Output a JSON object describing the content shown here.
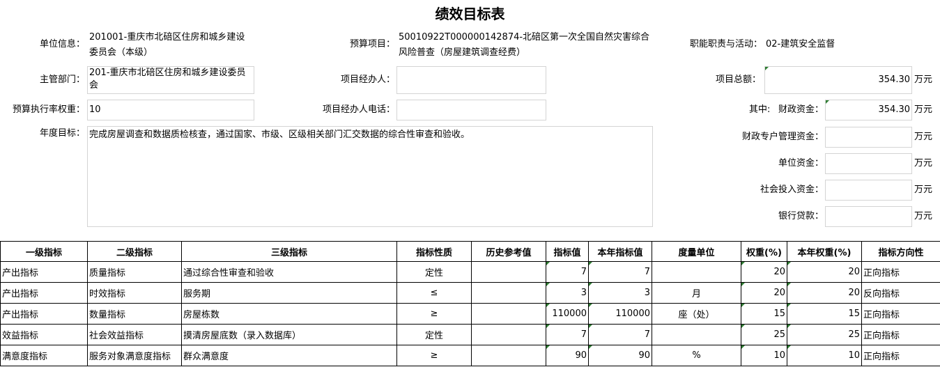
{
  "title": "绩效目标表",
  "fields": {
    "unit_info_label": "单位信息：",
    "unit_info_value_line1": "201001-重庆市北碚区住房和城乡建设",
    "unit_info_value_line2": "委员会（本级）",
    "budget_project_label": "预算项目：",
    "budget_project_value_line1": "50010922T000000142874-北碚区第一次全国自然灾害综合",
    "budget_project_value_line2": "风险普查（房屋建筑调查经费）",
    "function_label": "职能职责与活动：",
    "function_value": "02-建筑安全监督",
    "dept_label": "主管部门：",
    "dept_value_line1": "201-重庆市北碚区住房和城乡建设委员",
    "dept_value_line2": "会",
    "manager_label": "项目经办人：",
    "manager_value": "",
    "total_label": "项目总额：",
    "total_value": "354.30",
    "weight_label": "预算执行率权重：",
    "weight_value": "10",
    "manager_phone_label": "项目经办人电话：",
    "manager_phone_value": "",
    "fiscal_prefix": "其中:",
    "fiscal_label": "财政资金：",
    "fiscal_value": "354.30",
    "annual_goal_label": "年度目标：",
    "annual_goal_value": "完成房屋调查和数据质检核查，通过国家、市级、区级相关部门汇交数据的综合性审查和验收。",
    "special_label": "财政专户管理资金：",
    "special_value": "",
    "unit_funds_label": "单位资金：",
    "unit_funds_value": "",
    "social_label": "社会投入资金：",
    "social_value": "",
    "bank_label": "银行贷款：",
    "bank_value": "",
    "currency_unit": "万元"
  },
  "table": {
    "headers": [
      "一级指标",
      "二级指标",
      "三级指标",
      "指标性质",
      "历史参考值",
      "指标值",
      "本年指标值",
      "度量单位",
      "权重(%)",
      "本年权重(%)",
      "指标方向性"
    ],
    "rows": [
      {
        "l1": "产出指标",
        "l2": "质量指标",
        "l3": "通过综合性审查和验收",
        "nature": "定性",
        "history": "",
        "value": "7",
        "year_value": "7",
        "unit": "",
        "weight": "20",
        "year_weight": "20",
        "direction": "正向指标"
      },
      {
        "l1": "产出指标",
        "l2": "时效指标",
        "l3": "服务期",
        "nature": "≤",
        "history": "",
        "value": "3",
        "year_value": "3",
        "unit": "月",
        "weight": "20",
        "year_weight": "20",
        "direction": "反向指标"
      },
      {
        "l1": "产出指标",
        "l2": "数量指标",
        "l3": "房屋栋数",
        "nature": "≥",
        "history": "",
        "value": "110000",
        "year_value": "110000",
        "unit": "座（处）",
        "weight": "15",
        "year_weight": "15",
        "direction": "正向指标"
      },
      {
        "l1": "效益指标",
        "l2": "社会效益指标",
        "l3": "摸清房屋底数（录入数据库）",
        "nature": "定性",
        "history": "",
        "value": "7",
        "year_value": "7",
        "unit": "",
        "weight": "25",
        "year_weight": "25",
        "direction": "正向指标"
      },
      {
        "l1": "满意度指标",
        "l2": "服务对象满意度指标",
        "l3": "群众满意度",
        "nature": "≥",
        "history": "",
        "value": "90",
        "year_value": "90",
        "unit": "%",
        "weight": "10",
        "year_weight": "10",
        "direction": "正向指标"
      }
    ]
  },
  "colors": {
    "cell_marker": "#2e7d32",
    "input_border": "#d4d4d4"
  }
}
